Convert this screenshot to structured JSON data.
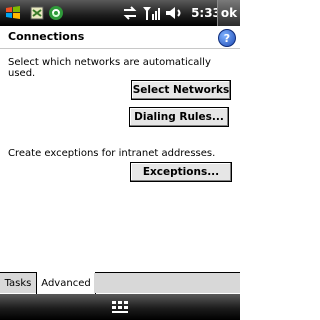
{
  "status": {
    "time": "5:33",
    "ok_label": "ok"
  },
  "title": {
    "text": "Connections",
    "help_label": "?"
  },
  "content": {
    "intro": "Select which networks are automatically used.",
    "select_networks": "Select Networks",
    "dialing_rules": "Dialing Rules...",
    "exceptions_text": "Create exceptions for intranet addresses.",
    "exceptions_button": "Exceptions..."
  },
  "tabs": {
    "tasks": "Tasks",
    "advanced": "Advanced"
  },
  "colors": {
    "help_blue": "#1f4bb5",
    "bar_dark": "#1c1c1c"
  }
}
